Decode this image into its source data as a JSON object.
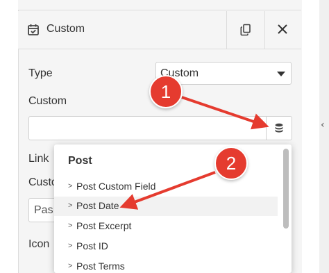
{
  "header": {
    "title": "Custom",
    "calendar_icon": "calendar-check-icon",
    "copy_icon": "copy-icon",
    "close_icon": "close-icon"
  },
  "fields": {
    "type_label": "Type",
    "type_value": "Custom",
    "custom_label": "Custom",
    "custom_value": "",
    "link_label": "Link",
    "custom2_label": "Custo",
    "pas_value": "Pas",
    "icon_label": "Icon"
  },
  "dropdown": {
    "group": "Post",
    "items": [
      {
        "label": "Post Custom Field"
      },
      {
        "label": "Post Date"
      },
      {
        "label": "Post Excerpt"
      },
      {
        "label": "Post ID"
      },
      {
        "label": "Post Terms"
      }
    ],
    "active_index": 1
  },
  "callouts": {
    "first": "1",
    "second": "2"
  },
  "colors": {
    "callout": "#e53b2f",
    "panel_bg": "#f5f5f5"
  }
}
